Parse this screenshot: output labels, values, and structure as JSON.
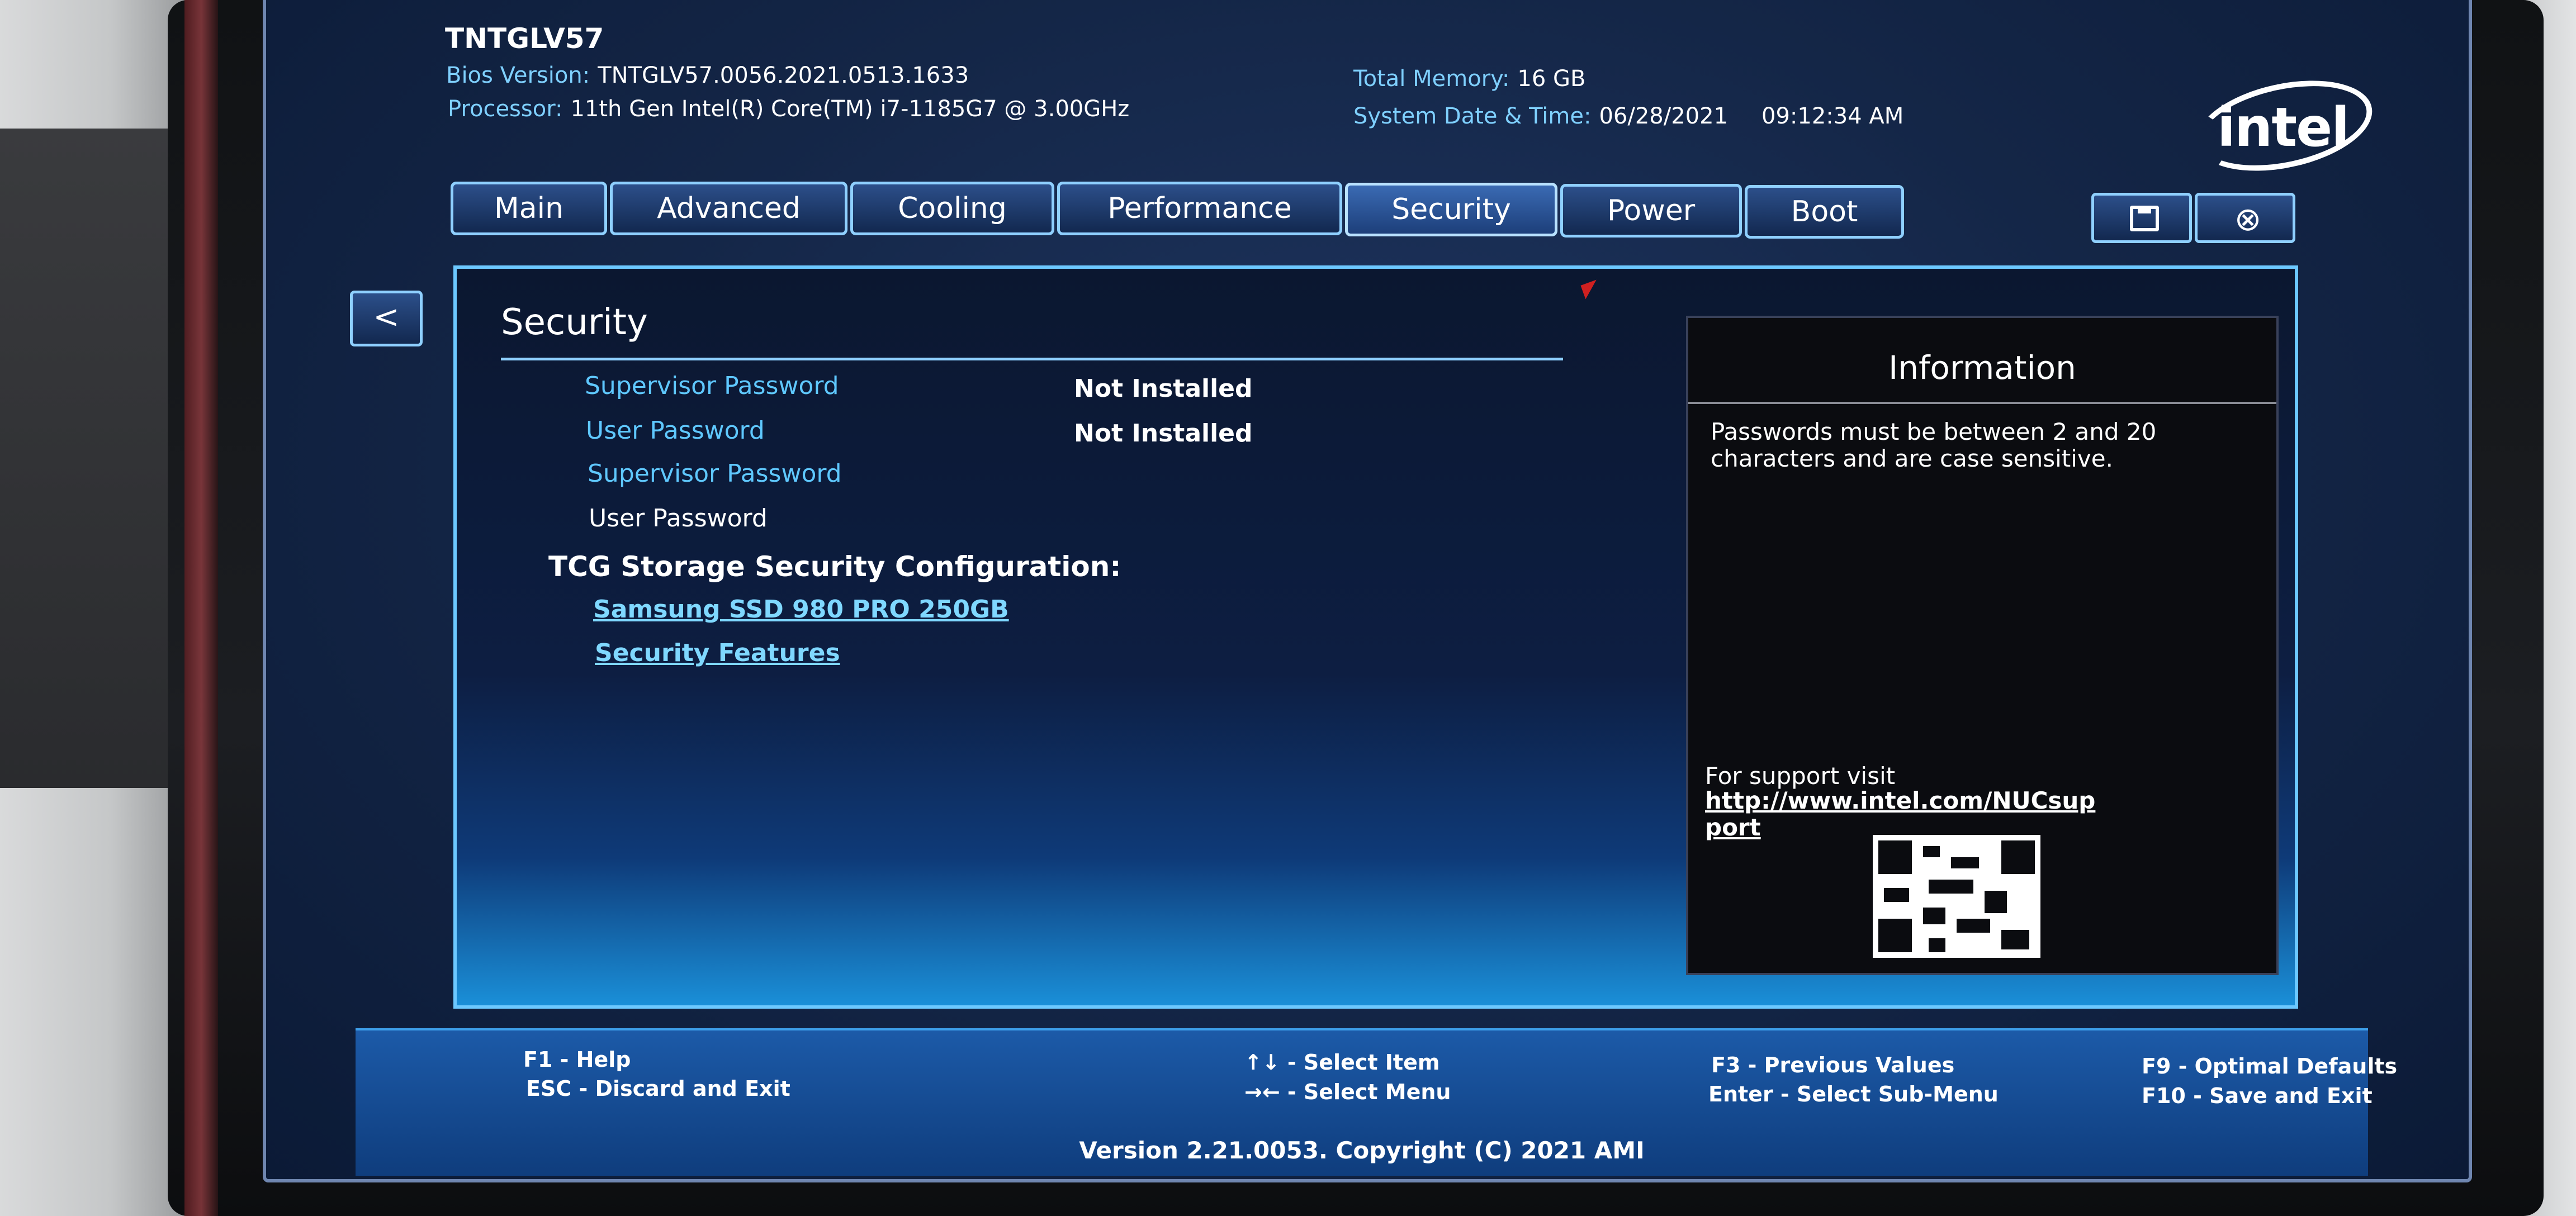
{
  "header": {
    "model": "TNTGLV57",
    "bios_label": "Bios Version:",
    "bios_value": "TNTGLV57.0056.2021.0513.1633",
    "processor_label": "Processor:",
    "processor_value": "11th Gen Intel(R) Core(TM) i7-1185G7 @ 3.00GHz",
    "memory_label": "Total Memory:",
    "memory_value": "16 GB",
    "datetime_label": "System Date & Time:",
    "date_value": "06/28/2021",
    "time_value": "09:12:34 AM",
    "logo_text": "intel"
  },
  "tabs": [
    {
      "label": "Main"
    },
    {
      "label": "Advanced"
    },
    {
      "label": "Cooling"
    },
    {
      "label": "Performance"
    },
    {
      "label": "Security"
    },
    {
      "label": "Power"
    },
    {
      "label": "Boot"
    }
  ],
  "active_tab": "Security",
  "toolbar": {
    "save_icon": "save-icon",
    "exit_icon": "close-icon",
    "back_label": "<"
  },
  "security": {
    "title": "Security",
    "supervisor_status_label": "Supervisor Password",
    "supervisor_status_value": "Not Installed",
    "user_status_label": "User Password",
    "user_status_value": "Not Installed",
    "set_supervisor_label": "Supervisor Password",
    "set_user_label": "User Password",
    "tcg_heading": "TCG Storage Security Configuration:",
    "drive_link": "Samsung SSD 980 PRO 250GB",
    "features_link": "Security Features"
  },
  "info": {
    "title": "Information",
    "text": "Passwords must be between 2 and 20 characters and are case sensitive.",
    "support_label": "For support visit",
    "support_url": "http://www.intel.com/NUCsupport"
  },
  "footer": {
    "f1": "F1 - Help",
    "esc": "ESC - Discard and Exit",
    "select_item": "↑↓ - Select Item",
    "select_menu": "→← - Select Menu",
    "f3": "F3 - Previous Values",
    "enter": "Enter - Select Sub-Menu",
    "f9": "F9 - Optimal Defaults",
    "f10": "F10 - Save and Exit",
    "copyright": "Version 2.21.0053. Copyright (C) 2021 AMI"
  },
  "colors": {
    "accent": "#8fd0ff",
    "label_blue": "#5fc8ff",
    "background": "#142647"
  }
}
